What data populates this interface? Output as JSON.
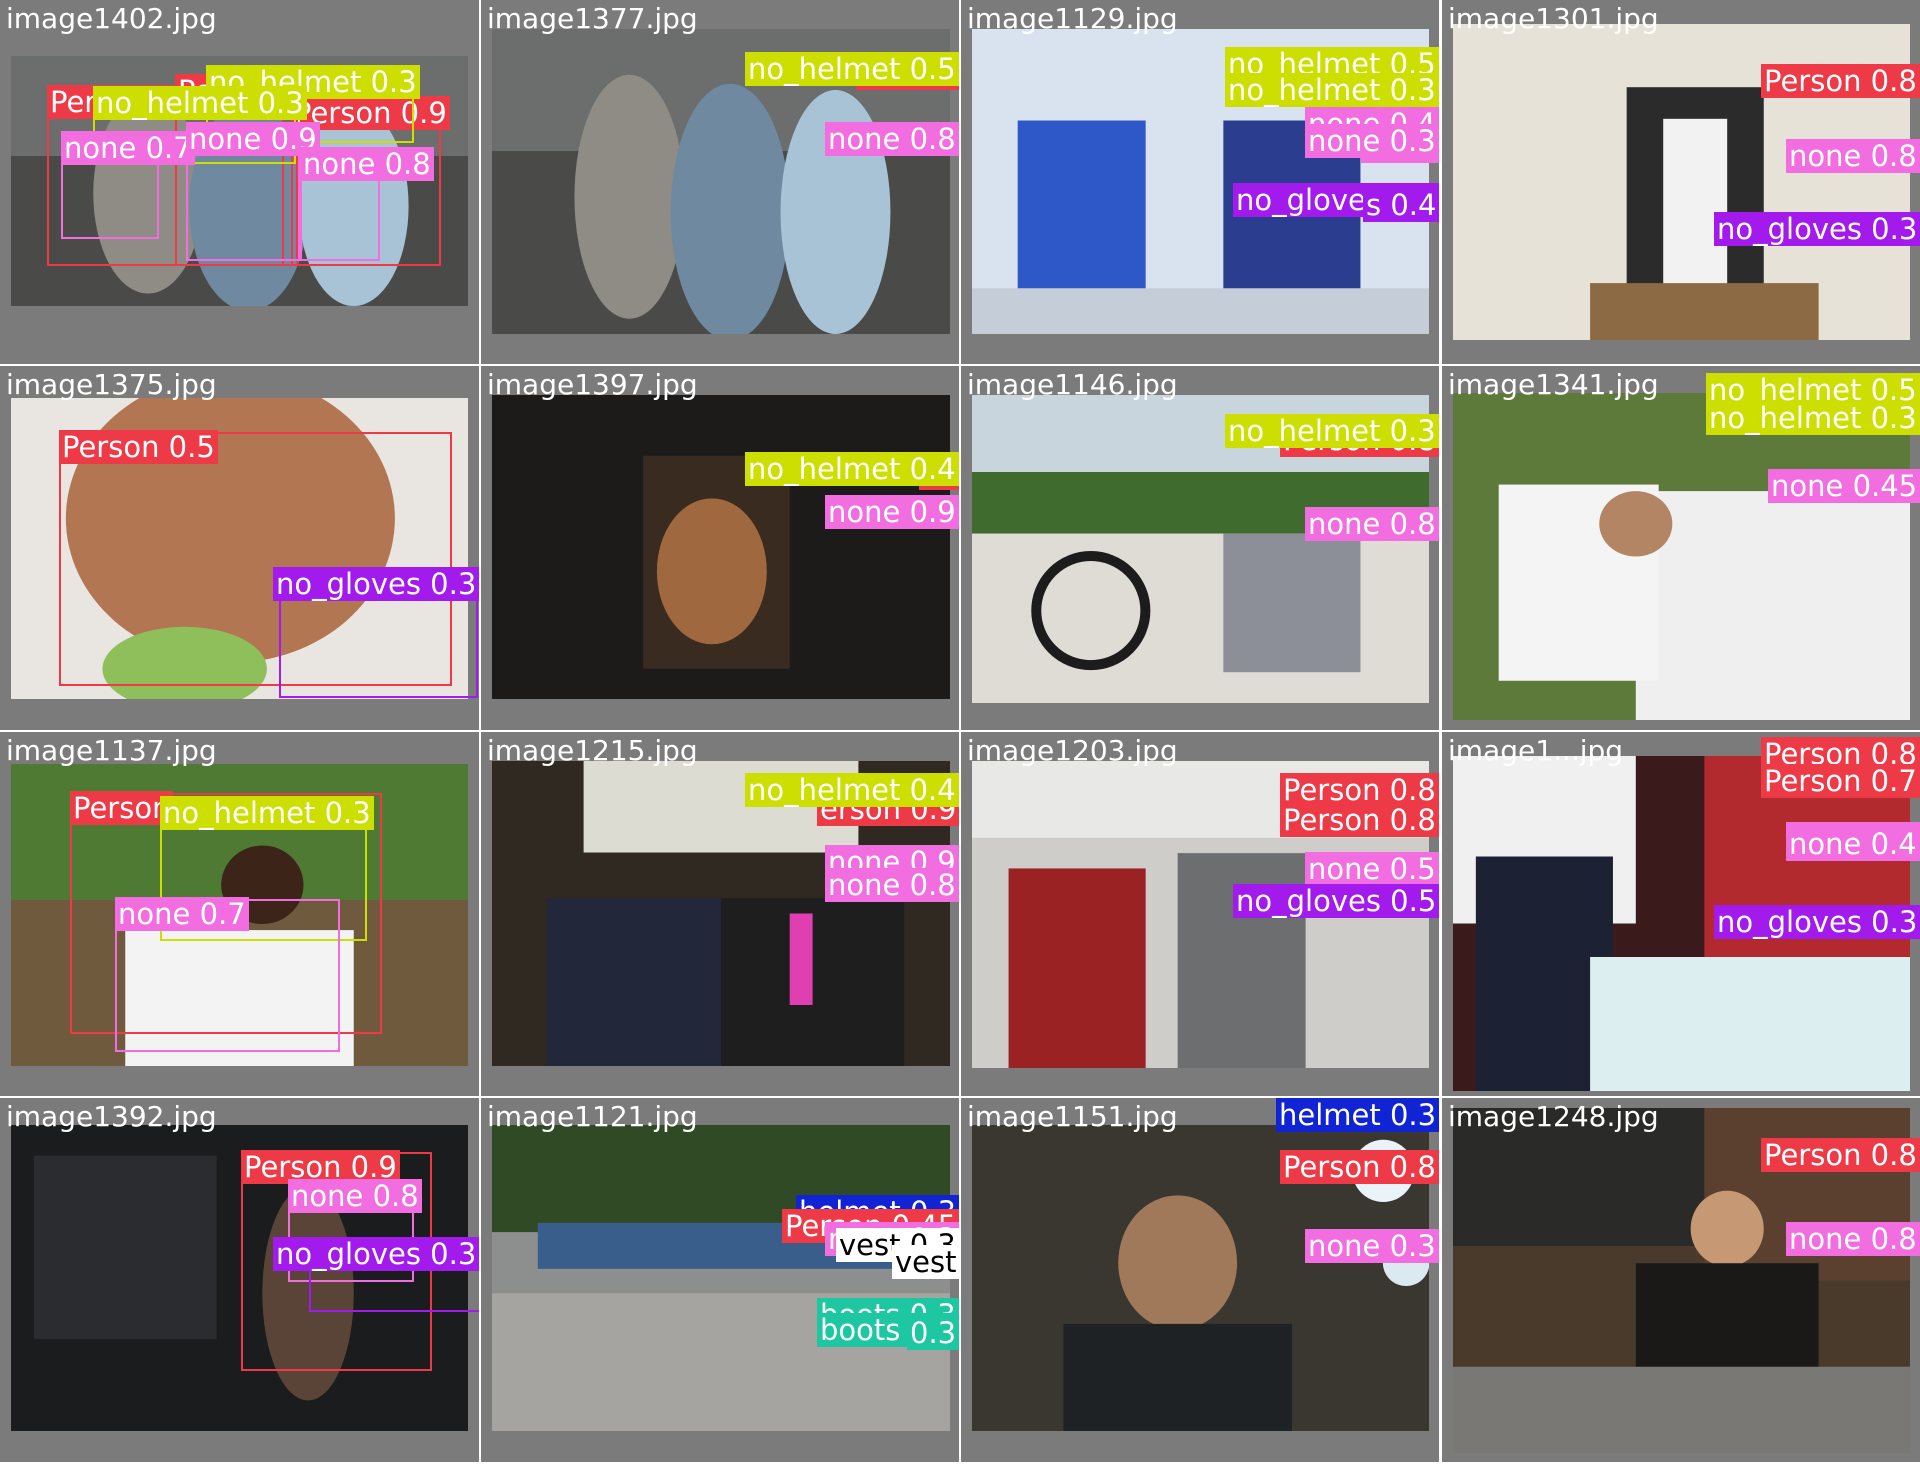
{
  "colors": {
    "Person": "#ee3a47",
    "none": "#f26ee0",
    "no_helmet": "#cddf00",
    "no_gloves": "#a21bec",
    "helmet": "#1024d6",
    "boots": "#1cc7a2",
    "vest": "#ffffff",
    "background": "#7b7b7b"
  },
  "tiles": [
    {
      "filename": "image1402.jpg",
      "scene": "gym",
      "detections": [
        {
          "label": "Person 0.8",
          "cls": "Person"
        },
        {
          "label": "Person 0.9",
          "cls": "Person"
        },
        {
          "label": "Person",
          "cls": "Person"
        },
        {
          "label": "no_helmet 0.3",
          "cls": "no_helmet"
        },
        {
          "label": "no_helmet 0.3",
          "cls": "no_helmet"
        },
        {
          "label": "none 0.7",
          "cls": "none"
        },
        {
          "label": "none 0.9",
          "cls": "none"
        },
        {
          "label": "none 0.8",
          "cls": "none"
        }
      ]
    },
    {
      "filename": "image1377.jpg",
      "scene": "gym",
      "detections": [
        {
          "label": "Person",
          "cls": "Person"
        },
        {
          "label": "no_helmet 0.5",
          "cls": "no_helmet"
        },
        {
          "label": "none 0.8",
          "cls": "none"
        }
      ]
    },
    {
      "filename": "image1129.jpg",
      "scene": "lab",
      "detections": [
        {
          "label": "Person",
          "cls": "Person"
        },
        {
          "label": "Person",
          "cls": "Person"
        },
        {
          "label": "no_helmet 0.5",
          "cls": "no_helmet"
        },
        {
          "label": "no_helmet 0.3",
          "cls": "no_helmet"
        },
        {
          "label": "none 0.4",
          "cls": "none"
        },
        {
          "label": "none",
          "cls": "none"
        },
        {
          "label": "none 0.3",
          "cls": "none"
        },
        {
          "label": "no_gloves 0.3",
          "cls": "no_gloves"
        },
        {
          "label": "s 0.4",
          "cls": "no_gloves"
        }
      ]
    },
    {
      "filename": "image1301.jpg",
      "scene": "podium",
      "detections": [
        {
          "label": "Person 0.8",
          "cls": "Person"
        },
        {
          "label": "none 0.8",
          "cls": "none"
        },
        {
          "label": "no_gloves 0.3",
          "cls": "no_gloves"
        }
      ]
    },
    {
      "filename": "image1375.jpg",
      "scene": "torso",
      "detections": [
        {
          "label": "Person 0.5",
          "cls": "Person"
        },
        {
          "label": "no_gloves 0.3",
          "cls": "no_gloves"
        }
      ]
    },
    {
      "filename": "image1397.jpg",
      "scene": "dark",
      "detections": [
        {
          "label": "Pe",
          "cls": "Person"
        },
        {
          "label": "no_helmet 0.4",
          "cls": "no_helmet"
        },
        {
          "label": "none 0.9",
          "cls": "none"
        }
      ]
    },
    {
      "filename": "image1146.jpg",
      "scene": "truck",
      "detections": [
        {
          "label": "Person 0.8",
          "cls": "Person"
        },
        {
          "label": "no_helmet 0.3",
          "cls": "no_helmet"
        },
        {
          "label": "none 0.8",
          "cls": "none"
        }
      ]
    },
    {
      "filename": "image1341.jpg",
      "scene": "signing",
      "detections": [
        {
          "label": "Person 0.",
          "cls": "Person"
        },
        {
          "label": "no_helmet 0.5",
          "cls": "no_helmet"
        },
        {
          "label": "no_helmet 0.3",
          "cls": "no_helmet"
        },
        {
          "label": "none 0.45",
          "cls": "none"
        }
      ]
    },
    {
      "filename": "image1137.jpg",
      "scene": "field",
      "detections": [
        {
          "label": "Person",
          "cls": "Person"
        },
        {
          "label": "no_helmet 0.3",
          "cls": "no_helmet"
        },
        {
          "label": "none 0.7",
          "cls": "none"
        }
      ]
    },
    {
      "filename": "image1215.jpg",
      "scene": "handshake",
      "detections": [
        {
          "label": "Perso",
          "cls": "Person"
        },
        {
          "label": "erson 0.9",
          "cls": "Person"
        },
        {
          "label": "no_helmet 0.4",
          "cls": "no_helmet"
        },
        {
          "label": "none 0.9",
          "cls": "none"
        },
        {
          "label": "none 0.8",
          "cls": "none"
        }
      ]
    },
    {
      "filename": "image1203.jpg",
      "scene": "office",
      "detections": [
        {
          "label": "Person 0.8",
          "cls": "Person"
        },
        {
          "label": "Person 0.8",
          "cls": "Person"
        },
        {
          "label": "none 0.",
          "cls": "none"
        },
        {
          "label": "none 0.5",
          "cls": "none"
        },
        {
          "label": "no_gloves 0.5",
          "cls": "no_gloves"
        }
      ]
    },
    {
      "filename": "image1...jpg",
      "scene": "wine",
      "detections": [
        {
          "label": "Person 0.8",
          "cls": "Person"
        },
        {
          "label": "Person 0.7",
          "cls": "Person"
        },
        {
          "label": "none 0.7",
          "cls": "none"
        },
        {
          "label": "none 0.4",
          "cls": "none"
        },
        {
          "label": "no_gloves 0.3",
          "cls": "no_gloves"
        }
      ]
    },
    {
      "filename": "image1392.jpg",
      "scene": "darkgym",
      "detections": [
        {
          "label": "Person 0.9",
          "cls": "Person"
        },
        {
          "label": "none 0.8",
          "cls": "none"
        },
        {
          "label": "no_gloves 0.3",
          "cls": "no_gloves"
        }
      ]
    },
    {
      "filename": "image1121.jpg",
      "scene": "river",
      "detections": [
        {
          "label": "helmet 0.3",
          "cls": "helmet"
        },
        {
          "label": "Person 0.45",
          "cls": "Person"
        },
        {
          "label": "none 0.3",
          "cls": "none"
        },
        {
          "label": "vest 0.3",
          "cls": "vest"
        },
        {
          "label": "vest",
          "cls": "vest"
        },
        {
          "label": "boots 0.3",
          "cls": "boots"
        },
        {
          "label": "boots 0.3",
          "cls": "boots"
        },
        {
          "label": "0.3",
          "cls": "boots"
        }
      ]
    },
    {
      "filename": "image1151.jpg",
      "scene": "drums",
      "detections": [
        {
          "label": "Person 0.8",
          "cls": "Person"
        },
        {
          "label": "none 0.3",
          "cls": "none"
        },
        {
          "label": "helmet 0.3",
          "cls": "helmet"
        }
      ]
    },
    {
      "filename": "image1248.jpg",
      "scene": "bar",
      "detections": [
        {
          "label": "Person 0.8",
          "cls": "Person"
        },
        {
          "label": "none 0.8",
          "cls": "none"
        }
      ]
    }
  ]
}
